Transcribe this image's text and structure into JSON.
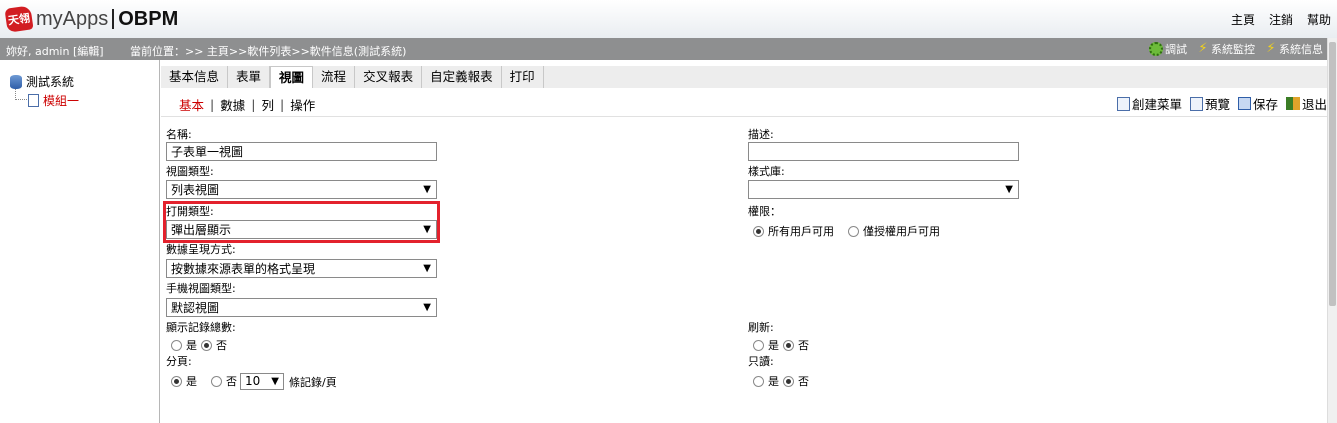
{
  "header": {
    "logo_mark": "天翎",
    "logo_text": "myApps",
    "logo_sub": "OBPM",
    "links": [
      "主頁",
      "注銷",
      "幫助"
    ]
  },
  "infobar": {
    "greeting": "妳好, admin [編輯]",
    "location": "當前位置：>> 主頁>>軟件列表>>軟件信息(測試系統)",
    "tools": [
      "調試",
      "系統監控",
      "系統信息"
    ]
  },
  "tree": {
    "root": "測試系統",
    "child": "模組一"
  },
  "tabs": [
    "基本信息",
    "表單",
    "視圖",
    "流程",
    "交叉報表",
    "自定義報表",
    "打印"
  ],
  "active_tab": "視圖",
  "subnav": [
    "基本",
    "數據",
    "列",
    "操作"
  ],
  "active_subnav": "基本",
  "actions": [
    "創建菜單",
    "預覽",
    "保存",
    "退出"
  ],
  "form": {
    "name_label": "名稱:",
    "name_value": "子表單一視圖",
    "view_type_label": "視圖類型:",
    "view_type_value": "列表視圖",
    "open_type_label": "打開類型:",
    "open_type_value": "彈出層顯示",
    "data_mode_label": "數據呈現方式:",
    "data_mode_value": "按數據來源表單的格式呈現",
    "mobile_view_label": "手機視圖類型:",
    "mobile_view_value": "默認視圖",
    "show_total_label": "顯示記錄總數:",
    "show_total_yes": "是",
    "show_total_no": "否",
    "paging_label": "分頁:",
    "paging_yes": "是",
    "paging_no": "否",
    "page_size": "10",
    "page_size_suffix": "條記錄/頁",
    "desc_label": "描述:",
    "desc_value": "",
    "style_label": "樣式庫:",
    "style_value": "",
    "perm_label": "權限：",
    "perm_all": "所有用戶可用",
    "perm_auth": "僅授權用戶可用",
    "refresh_label": "刷新:",
    "refresh_yes": "是",
    "refresh_no": "否",
    "readonly_label": "只讀:",
    "readonly_yes": "是",
    "readonly_no": "否"
  },
  "colors": {
    "highlight": "#e3222d",
    "active_link": "#cc0000",
    "infobar": "#8e8f90"
  }
}
